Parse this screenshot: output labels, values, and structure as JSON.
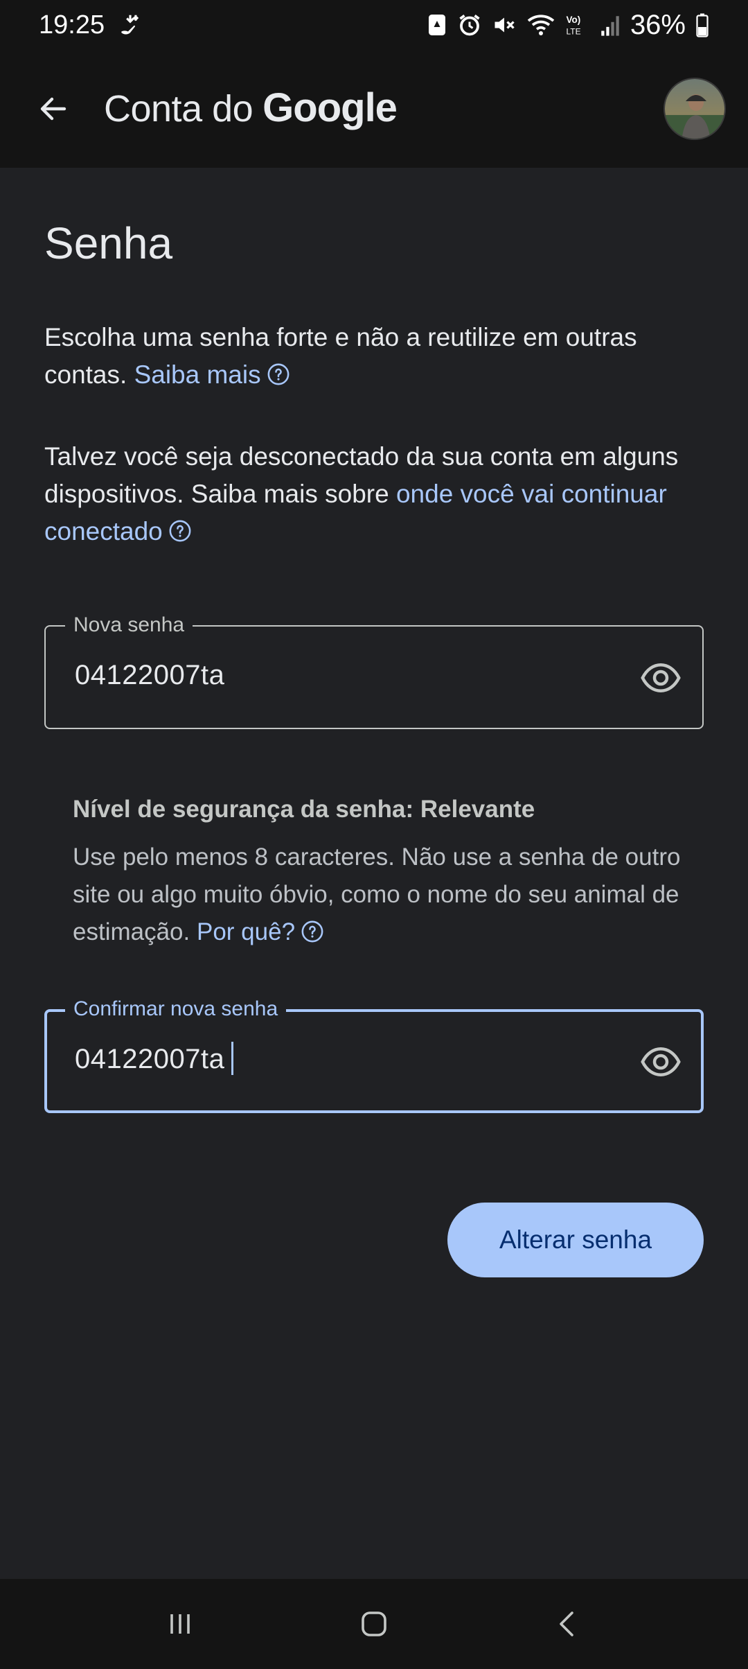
{
  "status_bar": {
    "time": "19:25",
    "battery": "36%",
    "icons": [
      "notification-icon",
      "lock-screen-icon",
      "alarm-icon",
      "mute-icon",
      "wifi-icon",
      "volte-icon",
      "signal-icon",
      "battery-icon"
    ]
  },
  "app_bar": {
    "title_prefix": "Conta do",
    "title_brand": "Google"
  },
  "page": {
    "title": "Senha",
    "intro_text": "Escolha uma senha forte e não a reutilize em outras contas.",
    "intro_link": "Saiba mais",
    "signout_text": "Talvez você seja desconectado da sua conta em alguns dispositivos. Saiba mais sobre",
    "signout_link": "onde você vai continuar conectado"
  },
  "new_password": {
    "label": "Nova senha",
    "value": "04122007ta"
  },
  "strength": {
    "title": "Nível de segurança da senha: Relevante",
    "description": "Use pelo menos 8 caracteres. Não use a senha de outro site ou algo muito óbvio, como o nome do seu animal de estimação.",
    "link": "Por quê?"
  },
  "confirm_password": {
    "label": "Confirmar nova senha",
    "value": "04122007ta"
  },
  "actions": {
    "submit_label": "Alterar senha"
  },
  "colors": {
    "background": "#202124",
    "bar": "#141414",
    "accent": "#a8c7fa",
    "button_text": "#062e6f"
  }
}
